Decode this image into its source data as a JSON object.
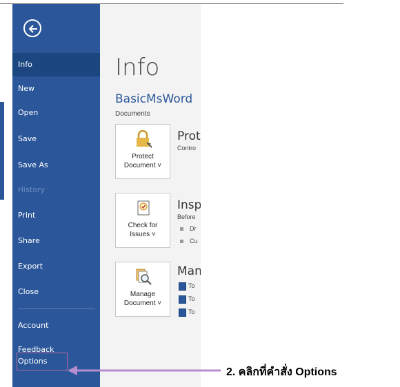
{
  "sidebar": {
    "items": [
      {
        "label": "Info",
        "state": "active"
      },
      {
        "label": "New",
        "state": "normal"
      },
      {
        "label": "Open",
        "state": "normal"
      },
      {
        "label": "Save",
        "state": "normal"
      },
      {
        "label": "Save As",
        "state": "normal"
      },
      {
        "label": "History",
        "state": "disabled"
      },
      {
        "label": "Print",
        "state": "normal"
      },
      {
        "label": "Share",
        "state": "normal"
      },
      {
        "label": "Export",
        "state": "normal"
      },
      {
        "label": "Close",
        "state": "normal"
      },
      {
        "label": "Account",
        "state": "normal"
      },
      {
        "label": "Feedback",
        "state": "normal"
      },
      {
        "label": "Options",
        "state": "highlighted"
      }
    ]
  },
  "main": {
    "title": "Info",
    "doc_name": "BasicMsWord",
    "doc_location": "Documents",
    "sections": {
      "protect": {
        "button_line1": "Protect",
        "button_line2": "Document",
        "heading": "Prote",
        "desc": "Contro"
      },
      "inspect": {
        "button_line1": "Check for",
        "button_line2": "Issues",
        "heading": "Inspe",
        "desc": "Before",
        "bullets": [
          "Dr",
          "Cu"
        ]
      },
      "manage": {
        "button_line1": "Manage",
        "button_line2": "Document",
        "heading": "Man",
        "items": [
          "To",
          "To",
          "To"
        ]
      }
    }
  },
  "callout": {
    "text": "2. คลิกที่คำสั่ง Options"
  },
  "colors": {
    "sidebar": "#2b579a",
    "active": "#1b4680",
    "highlight_border": "#b8679f",
    "arrow": "#b68ed0"
  },
  "icons": {
    "back": "back-arrow-icon",
    "protect": "lock-key-icon",
    "inspect": "document-check-icon",
    "manage": "document-search-icon",
    "word": "word-doc-icon"
  }
}
